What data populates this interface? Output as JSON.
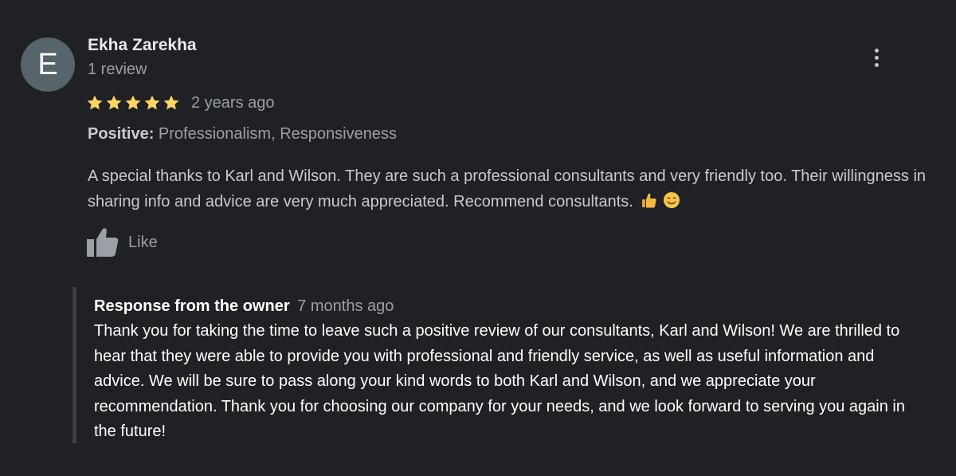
{
  "review": {
    "avatar_letter": "E",
    "author_name": "Ekha Zarekha",
    "review_count": "1 review",
    "rating": 5,
    "rating_max": 5,
    "time": "2 years ago",
    "tags": {
      "label": "Positive:",
      "values": "Professionalism, Responsiveness"
    },
    "text": "A special thanks to Karl and Wilson. They are such a professional consultants and very friendly too. Their willingness in sharing info and advice are very much appreciated. Recommend consultants.",
    "emojis": [
      "thumbs-up-emoji",
      "smiling-face-emoji"
    ],
    "like_label": "Like"
  },
  "owner_response": {
    "title": "Response from the owner",
    "time": "7 months ago",
    "text": "Thank you for taking the time to leave such a positive review of our consultants, Karl and Wilson! We are thrilled to hear that they were able to provide you with professional and friendly service, as well as useful information and advice. We will be sure to pass along your kind words to both Karl and Wilson, and we appreciate your recommendation. Thank you for choosing our company for your needs, and we look forward to serving you again in the future!"
  },
  "colors": {
    "background": "#202124",
    "avatar": "#56656b",
    "star": "#fdd663",
    "muted_text": "#9aa0a6",
    "response_bar": "#3c4043"
  },
  "icons": {
    "more": "more-vertical-icon",
    "like": "thumbs-up-icon",
    "star": "star-icon"
  }
}
